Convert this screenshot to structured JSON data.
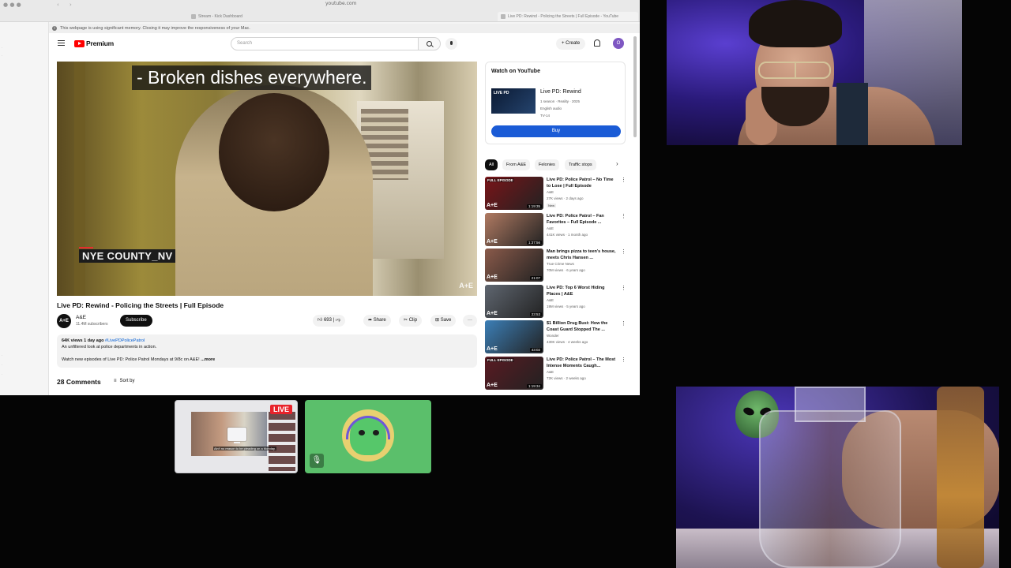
{
  "browser": {
    "url": "youtube.com",
    "tabs": [
      {
        "label": "Stream - Kick Dashboard"
      },
      {
        "label": "Live PD: Rewind - Policing the Streets | Full Episode - YouTube"
      }
    ],
    "memory_notice": "This webpage is using significant memory. Closing it may improve the responsiveness of your Mac."
  },
  "youtube": {
    "logo_text": "Premium",
    "search_placeholder": "Search",
    "create_label": "+ Create",
    "avatar_letter": "O",
    "player": {
      "caption": "- Broken dishes everywhere.",
      "location": "NYE COUNTY_NV",
      "network_bug": "A+E"
    },
    "video": {
      "title": "Live PD: Rewind - Policing the Streets | Full Episode",
      "channel": "A&E",
      "channel_avatar": "A+E",
      "subscribers": "11.4M subscribers",
      "subscribe_label": "Subscribe",
      "likes": "693",
      "share_label": "Share",
      "clip_label": "Clip",
      "save_label": "Save",
      "more_label": "···"
    },
    "description": {
      "stats": "64K views  1 day ago",
      "hashtag": "#LivePDPolicePatrol",
      "line1": "An unfiltered look at police departments in action.",
      "line2": "Watch new episodes of Live PD: Police Patrol Mondays at 9/8c on A&E!",
      "more": "...more"
    },
    "comments": {
      "count_label": "28 Comments",
      "sort_label": "Sort by"
    },
    "watch_card": {
      "heading": "Watch on YouTube",
      "thumb_text": "LIVE PD",
      "show_title": "Live PD: Rewind",
      "meta1": "1 season · Reality · 2025",
      "meta2": "English audio",
      "rating": "TV-14",
      "buy_label": "Buy"
    },
    "chips": [
      {
        "label": "All"
      },
      {
        "label": "From A&E"
      },
      {
        "label": "Felonies"
      },
      {
        "label": "Traffic stops"
      }
    ],
    "recommendations": [
      {
        "title": "Live PD: Police Patrol – No Time to Lose | Full Episode",
        "channel": "A&E",
        "stats": "27K views · 2 days ago",
        "duration": "1:19:35",
        "badge": "FULL EPISODE",
        "new": "New",
        "thumb_color": "#7a1418"
      },
      {
        "title": "Live PD: Police Patrol – Fan Favorites – Full Episode ...",
        "channel": "A&E",
        "stats": "441K views · 1 month ago",
        "duration": "1:37:56",
        "badge": "",
        "new": "",
        "thumb_color": "#b07a62"
      },
      {
        "title": "Man brings pizza to teen's house, meets Chris Hansen ...",
        "channel": "True Crime News",
        "stats": "70M views · 6 years ago",
        "duration": "21:07",
        "badge": "",
        "new": "",
        "thumb_color": "#8a5a4a"
      },
      {
        "title": "Live PD: Top 6 Worst Hiding Places | A&E",
        "channel": "A&E",
        "stats": "19M views · 5 years ago",
        "duration": "23:53",
        "badge": "",
        "new": "",
        "thumb_color": "#5f6670"
      },
      {
        "title": "$1 Billion Drug Bust: How the Coast Guard Stopped The ...",
        "channel": "Wonder",
        "stats": "430K views · 4 weeks ago",
        "duration": "43:02",
        "badge": "",
        "new": "",
        "thumb_color": "#3c7fb7"
      },
      {
        "title": "Live PD: Police Patrol – The Most Intense Moments Caugh...",
        "channel": "A&E",
        "stats": "72K views · 2 weeks ago",
        "duration": "1:19:34",
        "badge": "FULL EPISODE",
        "new": "",
        "thumb_color": "#5a1a22"
      }
    ]
  },
  "participants": {
    "live_label": "LIVE",
    "mini_caption": "Ain't no reason to be pleading on a Monday."
  },
  "colors": {
    "youtube_red": "#ff0000",
    "buy_blue": "#1a5bd6",
    "live_red": "#e8232b",
    "avatar_tile_green": "#5bbf6b"
  }
}
